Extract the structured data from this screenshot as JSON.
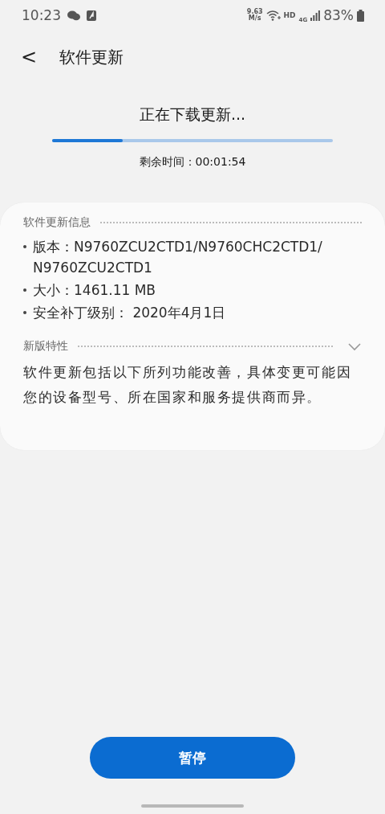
{
  "status_bar": {
    "time": "10:23",
    "speed_value": "9.63",
    "speed_unit": "M/s",
    "hd": "HD",
    "network": "4G",
    "battery": "83%"
  },
  "header": {
    "back": "<",
    "title": "软件更新"
  },
  "download": {
    "title": "正在下载更新...",
    "level": 0.25,
    "remaining": "剩余时间：00:01:54"
  },
  "info": {
    "heading": "软件更新信息",
    "items": [
      {
        "text": "版本：N9760ZCU2CTD1/N9760CHC2CTD1/ N9760ZCU2CTD1"
      },
      {
        "text": "大小：1461.11 MB"
      },
      {
        "text": "安全补丁级别： 2020年4月1日"
      }
    ]
  },
  "features": {
    "heading": "新版特性",
    "description": "软件更新包括以下所列功能改善，具体变更可能因您的设备型号、所在国家和服务提供商而异。"
  },
  "buttons": [
    {
      "label": "暂停"
    }
  ]
}
